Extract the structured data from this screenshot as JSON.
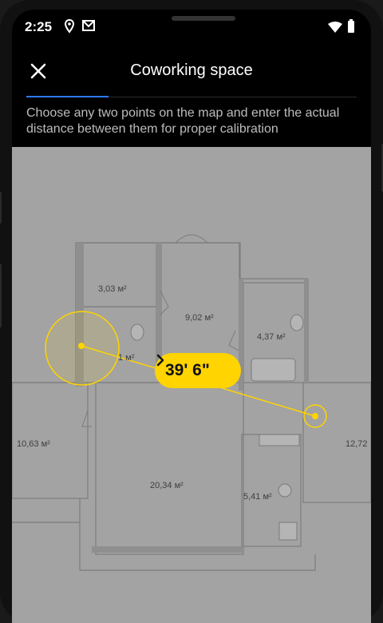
{
  "status_bar": {
    "time": "2:25"
  },
  "header": {
    "title": "Coworking space"
  },
  "instruction": "Choose any two points on the map and enter the actual distance between them for proper calibration",
  "floor_plan": {
    "rooms": [
      {
        "id": "r1",
        "label": "3,03 м²"
      },
      {
        "id": "r2",
        "label": "9,02 м²"
      },
      {
        "id": "r3",
        "label": "4,37 м²"
      },
      {
        "id": "r4",
        "label": "1 м²"
      },
      {
        "id": "r5",
        "label": "10,63 м²"
      },
      {
        "id": "r6",
        "label": "20,34 м²"
      },
      {
        "id": "r7",
        "label": "5,41 м²"
      },
      {
        "id": "r8",
        "label": "12,72"
      }
    ]
  },
  "calibration": {
    "distance_label": "39' 6\""
  },
  "colors": {
    "accent": "#ffd400",
    "tab_indicator": "#2f7bff",
    "background": "#000000"
  }
}
